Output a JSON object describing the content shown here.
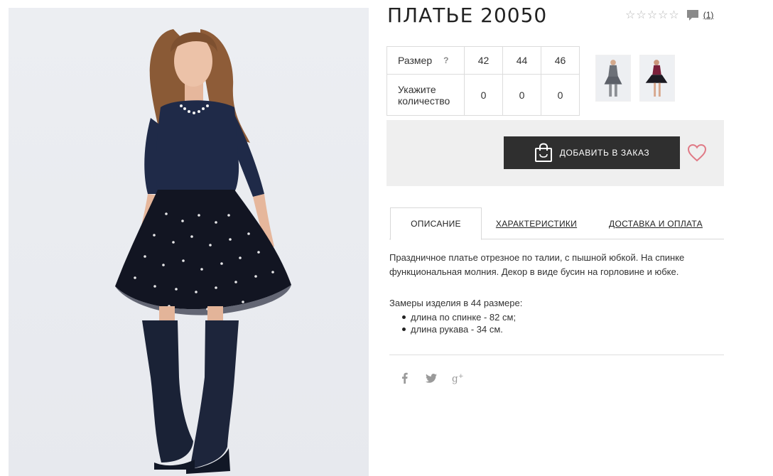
{
  "product": {
    "title": "ПЛАТЬЕ 20050",
    "reviews_link": "(1)"
  },
  "rating": {
    "stars": [
      "☆",
      "☆",
      "☆",
      "☆",
      "☆"
    ],
    "value": 0,
    "max": 5
  },
  "size_table": {
    "size_label": "Размер",
    "help_mark": "?",
    "quantity_label_line1": "Укажите",
    "quantity_label_line2": "количество",
    "sizes": [
      "42",
      "44",
      "46"
    ],
    "quantities": [
      "0",
      "0",
      "0"
    ]
  },
  "order": {
    "add_button_label": "ДОБАВИТЬ В ЗАКАЗ"
  },
  "tabs": [
    {
      "label": "ОПИСАНИЕ",
      "active": true
    },
    {
      "label": "ХАРАКТЕРИСТИКИ",
      "active": false
    },
    {
      "label": "ДОСТАВКА И ОПЛАТА",
      "active": false
    }
  ],
  "description": {
    "line1": "Праздничное платье отрезное по талии, с пышной юбкой. На спинке",
    "line2": "функциональная молния. Декор в виде бусин на горловине и юбке.",
    "measures_title": "Замеры изделия в 44 размере:",
    "measures": [
      "длина по спинке - 82 см;",
      "длина рукава - 34 см."
    ]
  },
  "social": {
    "icons": [
      "facebook-icon",
      "twitter-icon",
      "google-plus-icon"
    ]
  },
  "colors": {
    "button_bg": "#2f2f2f",
    "heart": "#e07a86",
    "order_box_bg": "#efefef",
    "dress_top": "#1f2a48",
    "dress_skirt": "#121522"
  }
}
